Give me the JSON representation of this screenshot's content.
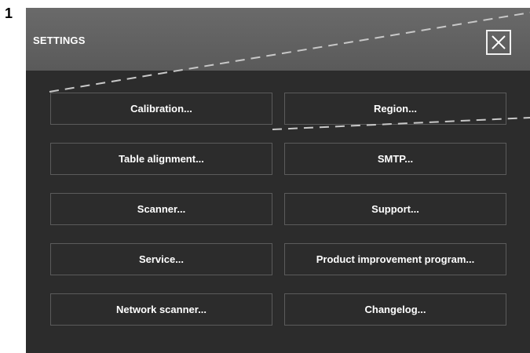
{
  "step": {
    "number": "1"
  },
  "window": {
    "title": "SETTINGS",
    "close_icon": "close-icon"
  },
  "buttons": [
    {
      "label": "Calibration..."
    },
    {
      "label": "Region..."
    },
    {
      "label": "Table alignment..."
    },
    {
      "label": "SMTP..."
    },
    {
      "label": "Scanner..."
    },
    {
      "label": "Support..."
    },
    {
      "label": "Service..."
    },
    {
      "label": "Product improvement program..."
    },
    {
      "label": "Network scanner..."
    },
    {
      "label": "Changelog..."
    }
  ],
  "colors": {
    "window_background": "#2c2c2c",
    "title_bar": "#5f5f5f",
    "button_border": "#5b5b5b",
    "text": "#ffffff",
    "annotation_line": "#c8c8c8"
  }
}
